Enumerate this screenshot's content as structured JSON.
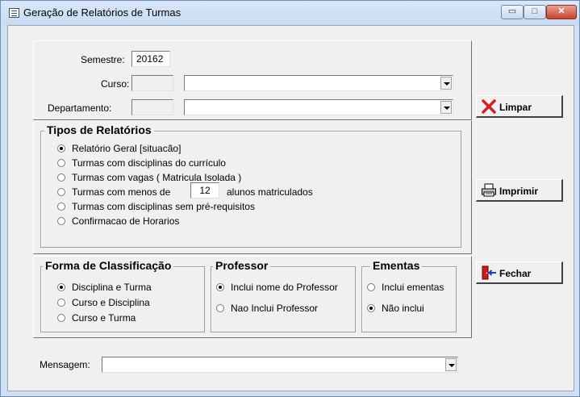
{
  "window": {
    "title": "Geração de Relatórios de Turmas"
  },
  "titlebar": {
    "min_glyph": "▭",
    "max_glyph": "□",
    "close_glyph": "✕"
  },
  "fields": {
    "semestre": {
      "label": "Semestre:",
      "value": "20162"
    },
    "curso": {
      "label": "Curso:",
      "code": "",
      "value": ""
    },
    "departamento": {
      "label": "Departamento:",
      "code": "",
      "value": ""
    }
  },
  "tipos": {
    "legend": "Tipos de Relatórios",
    "options": [
      {
        "label": "Relatório Geral  [situacão]",
        "selected": true
      },
      {
        "label": "Turmas com disciplinas do currículo",
        "selected": false
      },
      {
        "label": "Turmas com vagas ( Matricula Isolada )",
        "selected": false
      },
      {
        "label": "Turmas com menos de",
        "selected": false
      },
      {
        "label": "Turmas com disciplinas sem pré-requisitos",
        "selected": false
      },
      {
        "label": "Confirmacao de Horarios",
        "selected": false
      }
    ],
    "menos_value": "12",
    "menos_suffix": "alunos matriculados"
  },
  "classificacao": {
    "legend": "Forma de Classificação",
    "options": [
      {
        "label": "Disciplina e Turma",
        "selected": true
      },
      {
        "label": "Curso e Disciplina",
        "selected": false
      },
      {
        "label": "Curso e Turma",
        "selected": false
      }
    ]
  },
  "professor": {
    "legend": "Professor",
    "options": [
      {
        "label": "Inclui nome do Professor",
        "selected": true
      },
      {
        "label": "Nao Inclui Professor",
        "selected": false
      }
    ]
  },
  "ementas": {
    "legend": "Ementas",
    "options": [
      {
        "label": "Inclui ementas",
        "selected": false
      },
      {
        "label": "Não inclui",
        "selected": true
      }
    ]
  },
  "mensagem": {
    "label": "Mensagem:",
    "value": ""
  },
  "buttons": {
    "limpar": "Limpar",
    "imprimir": "Imprimir",
    "fechar": "Fechar"
  }
}
